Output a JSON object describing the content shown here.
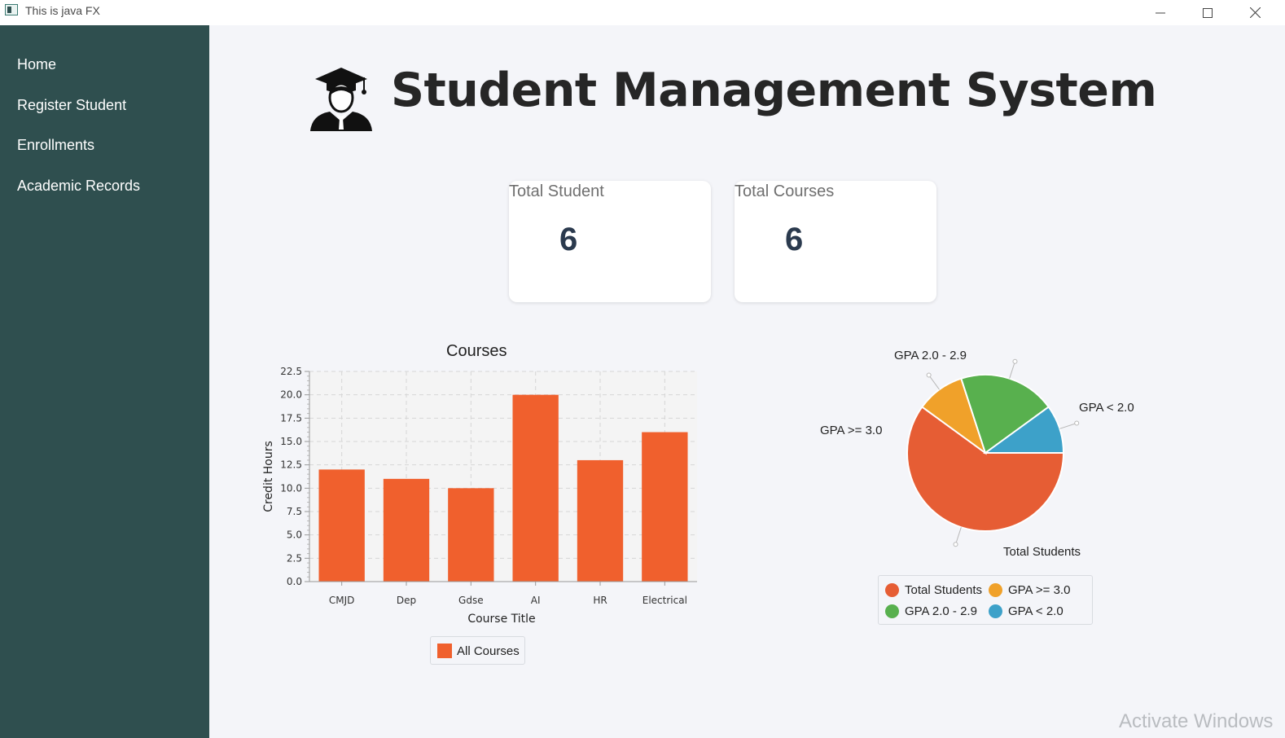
{
  "window": {
    "title": "This is java FX",
    "min_icon": "minimize-icon",
    "max_icon": "maximize-icon",
    "close_icon": "close-icon"
  },
  "sidebar": {
    "items": [
      {
        "label": "Home"
      },
      {
        "label": "Register Student"
      },
      {
        "label": "Enrollments"
      },
      {
        "label": "Academic Records"
      }
    ]
  },
  "header": {
    "logo_icon": "graduate-icon",
    "title": "Student Management System"
  },
  "stats": [
    {
      "label": "Total Student",
      "value": "6"
    },
    {
      "label": "Total Courses",
      "value": "6"
    }
  ],
  "chart_data": [
    {
      "type": "bar",
      "title": "Courses",
      "xlabel": "Course Title",
      "ylabel": "Credit Hours",
      "categories": [
        "CMJD",
        "Dep",
        "Gdse",
        "AI",
        "HR",
        "Electrical"
      ],
      "series": [
        {
          "name": "All Courses",
          "values": [
            12,
            11,
            10,
            20,
            13,
            16
          ],
          "color": "#f0602d"
        }
      ],
      "ylim": [
        0,
        22.5
      ],
      "yticks": [
        "0.0",
        "2.5",
        "5.0",
        "7.5",
        "10.0",
        "12.5",
        "15.0",
        "17.5",
        "20.0",
        "22.5"
      ],
      "grid": true,
      "legend": "bottom"
    },
    {
      "type": "pie",
      "slices": [
        {
          "label": "Total Students",
          "value": 6,
          "color": "#e65d34"
        },
        {
          "label": "GPA >= 3.0",
          "value": 1,
          "color": "#f0a12a"
        },
        {
          "label": "GPA 2.0 - 2.9",
          "value": 2,
          "color": "#58b04e"
        },
        {
          "label": "GPA < 2.0",
          "value": 1,
          "color": "#3da1c9"
        }
      ],
      "legend": "bottom"
    }
  ],
  "watermark": "Activate Windows"
}
